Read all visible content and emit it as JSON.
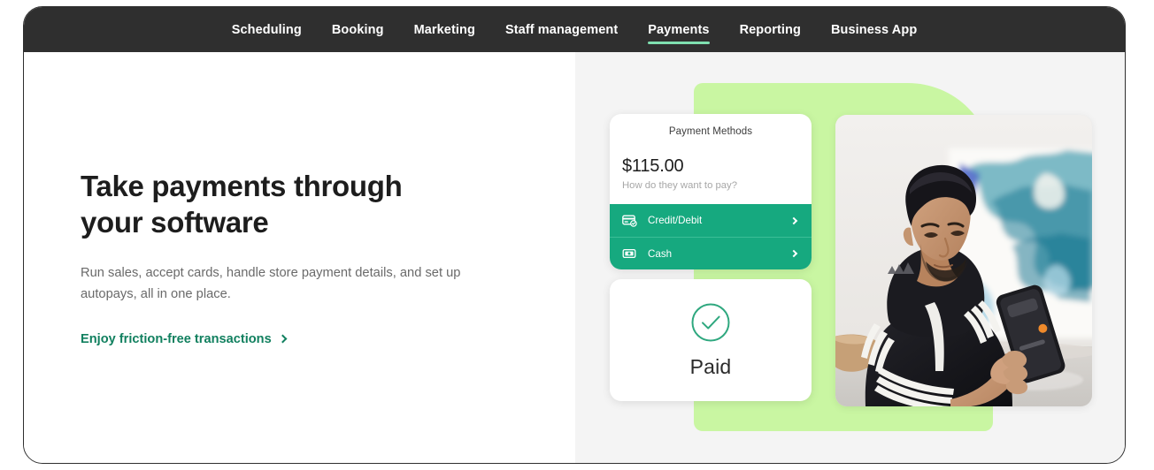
{
  "nav": {
    "items": [
      {
        "label": "Scheduling",
        "active": false
      },
      {
        "label": "Booking",
        "active": false
      },
      {
        "label": "Marketing",
        "active": false
      },
      {
        "label": "Staff management",
        "active": false
      },
      {
        "label": "Payments",
        "active": true
      },
      {
        "label": "Reporting",
        "active": false
      },
      {
        "label": "Business App",
        "active": false
      }
    ],
    "active_underline_color": "#7fdfb0",
    "background_color": "#2f2f2f"
  },
  "hero": {
    "headline": "Take payments through your software",
    "subcopy": "Run sales, accept cards, handle store payment details, and set up autopays, all in one place.",
    "cta_label": "Enjoy friction-free transactions",
    "cta_color": "#11805f"
  },
  "showcase": {
    "green_block_color": "#c9f6a2",
    "payment_card": {
      "title": "Payment Methods",
      "amount": "$115.00",
      "prompt": "How do they want to pay?",
      "row_color": "#16a97f",
      "rows": [
        {
          "label": "Credit/Debit",
          "icon": "credit-card-check-icon"
        },
        {
          "label": "Cash",
          "icon": "banknote-icon"
        }
      ]
    },
    "paid_card": {
      "label": "Paid",
      "icon": "check-circle-icon",
      "icon_color": "#2fa87f"
    },
    "photo": {
      "alt": "Man in black track jacket using a smartphone at a table",
      "decorative": true
    }
  }
}
